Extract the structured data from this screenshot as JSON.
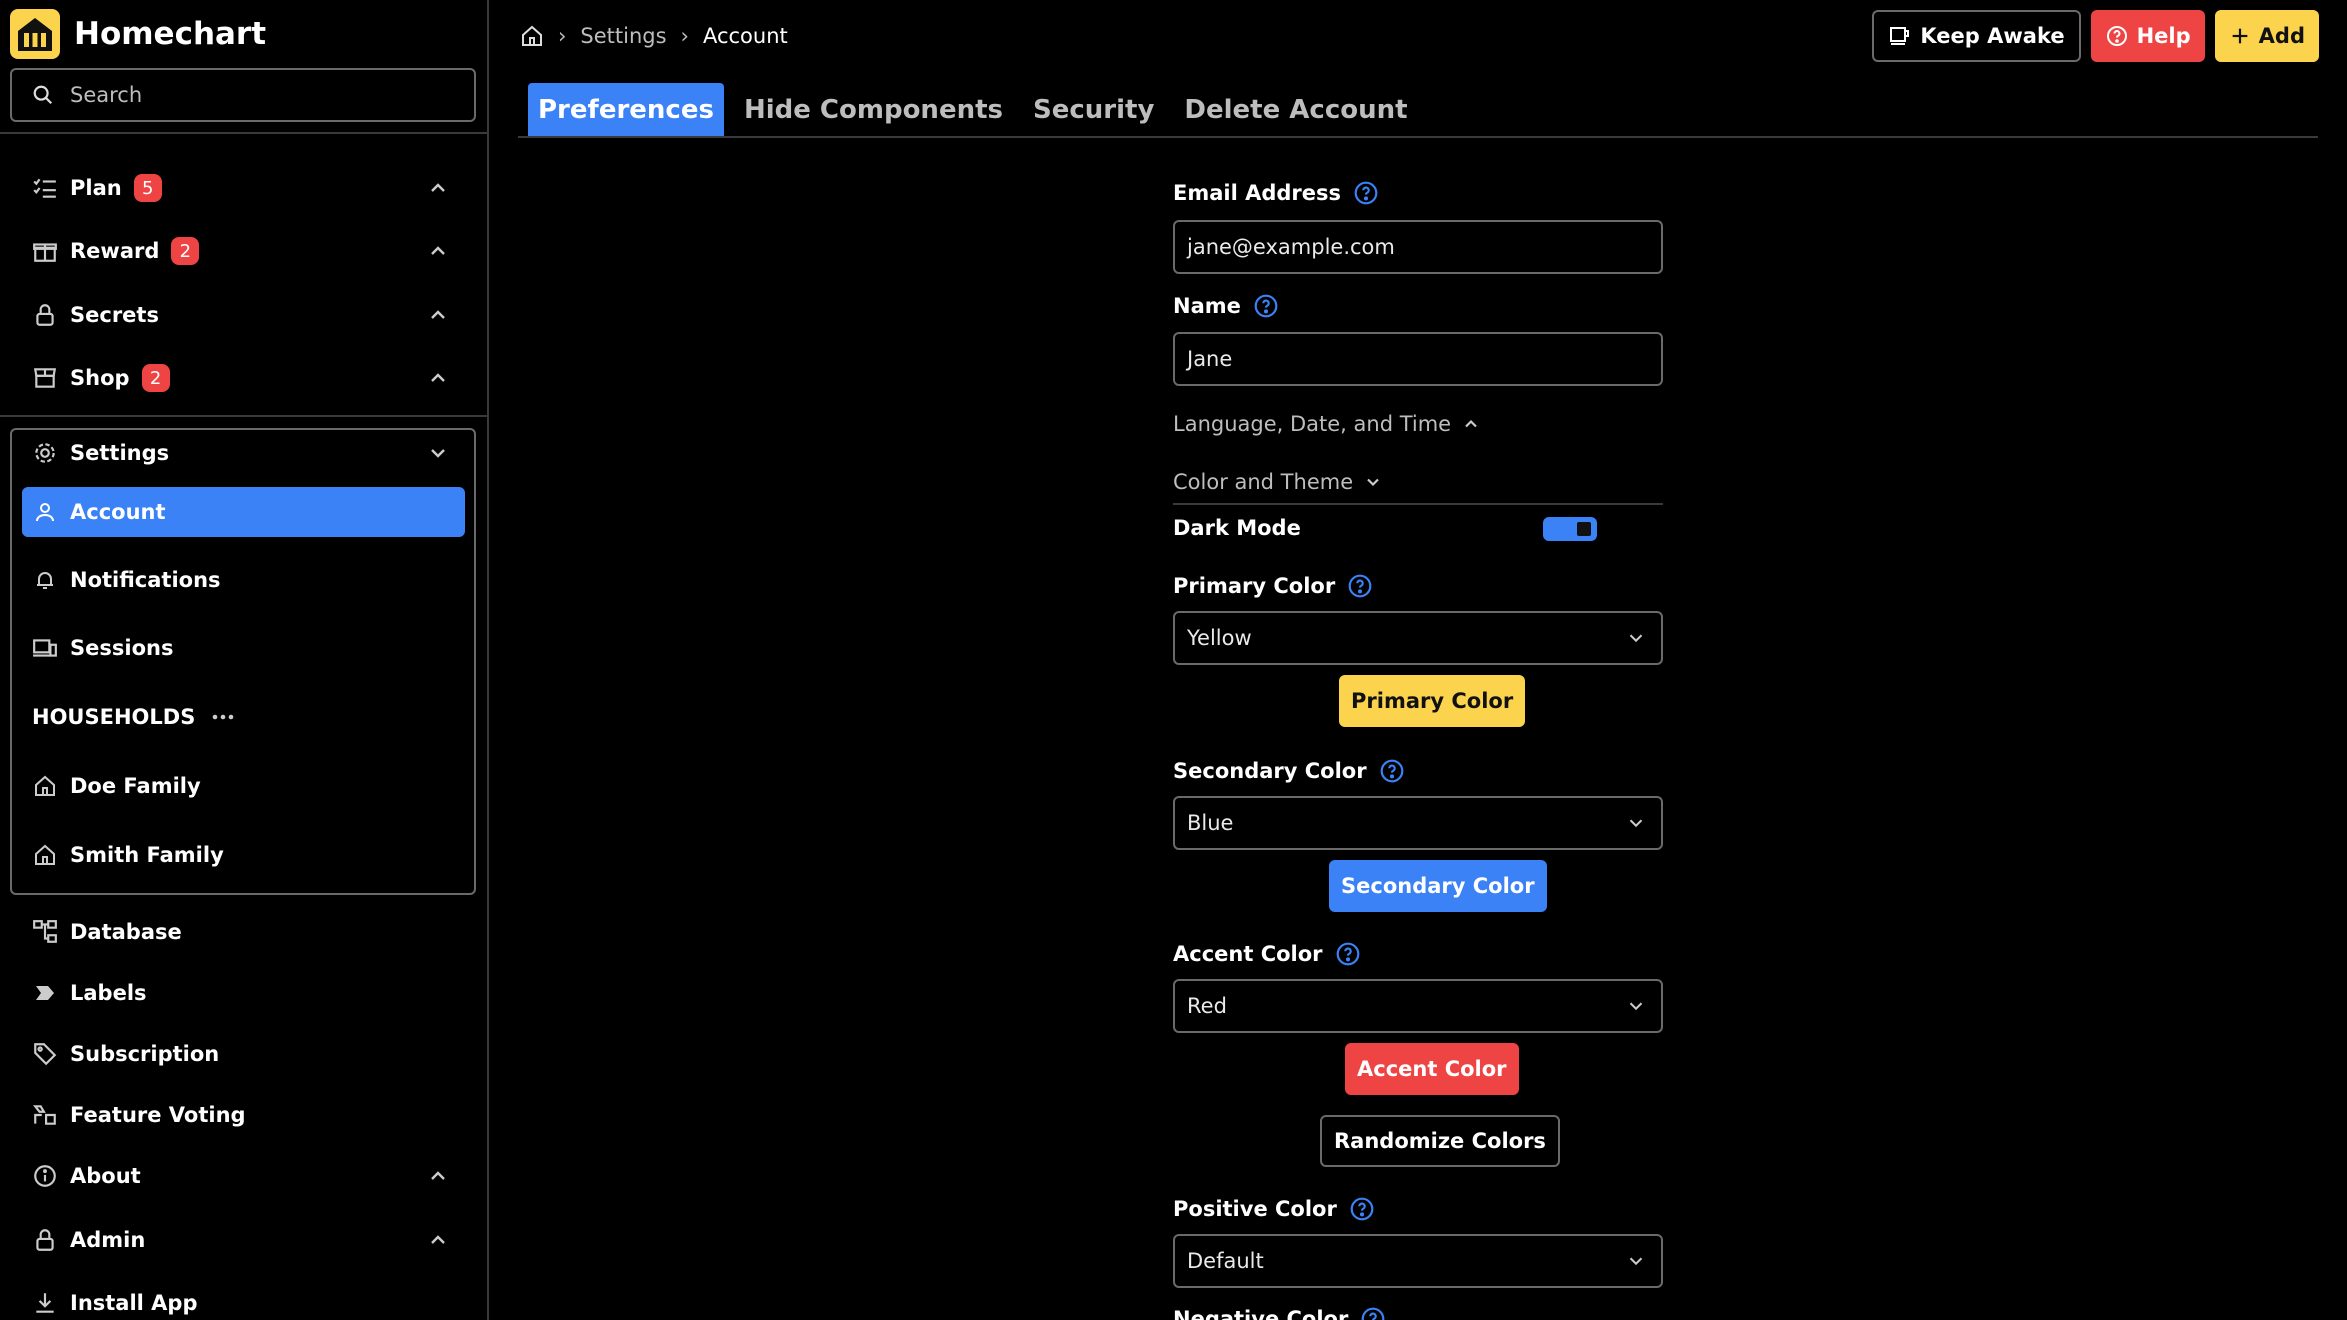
{
  "app": {
    "name": "Homechart",
    "search_placeholder": "Search"
  },
  "sidebar": {
    "main_items": [
      {
        "label": "Plan",
        "badge": "5"
      },
      {
        "label": "Reward",
        "badge": "2"
      },
      {
        "label": "Secrets"
      },
      {
        "label": "Shop",
        "badge": "2"
      }
    ],
    "settings": {
      "label": "Settings",
      "items": [
        {
          "label": "Account"
        },
        {
          "label": "Notifications"
        },
        {
          "label": "Sessions"
        }
      ],
      "households_label": "HOUSEHOLDS",
      "households": [
        {
          "label": "Doe Family"
        },
        {
          "label": "Smith Family"
        }
      ]
    },
    "bottom_items": [
      {
        "label": "Database"
      },
      {
        "label": "Labels"
      },
      {
        "label": "Subscription"
      },
      {
        "label": "Feature Voting"
      },
      {
        "label": "About"
      },
      {
        "label": "Admin"
      },
      {
        "label": "Install App"
      }
    ]
  },
  "breadcrumb": [
    "Settings",
    "Account"
  ],
  "top_actions": {
    "keep_awake": "Keep Awake",
    "help": "Help",
    "add": "Add"
  },
  "tabs": [
    {
      "label": "Preferences",
      "active": true
    },
    {
      "label": "Hide Components"
    },
    {
      "label": "Security"
    },
    {
      "label": "Delete Account"
    }
  ],
  "form": {
    "email_label": "Email Address",
    "email_value": "jane@example.com",
    "name_label": "Name",
    "name_value": "Jane",
    "section_language": "Language, Date, and Time",
    "section_color": "Color and Theme",
    "dark_mode_label": "Dark Mode",
    "dark_mode_on": true,
    "primary_label": "Primary Color",
    "primary_value": "Yellow",
    "primary_button": "Primary Color",
    "secondary_label": "Secondary Color",
    "secondary_value": "Blue",
    "secondary_button": "Secondary Color",
    "accent_label": "Accent Color",
    "accent_value": "Red",
    "accent_button": "Accent Color",
    "randomize_button": "Randomize Colors",
    "positive_label": "Positive Color",
    "positive_value": "Default",
    "negative_label": "Negative Color"
  },
  "colors": {
    "primary": "#fcd34d",
    "secondary": "#3b82f6",
    "accent": "#ef4444"
  }
}
